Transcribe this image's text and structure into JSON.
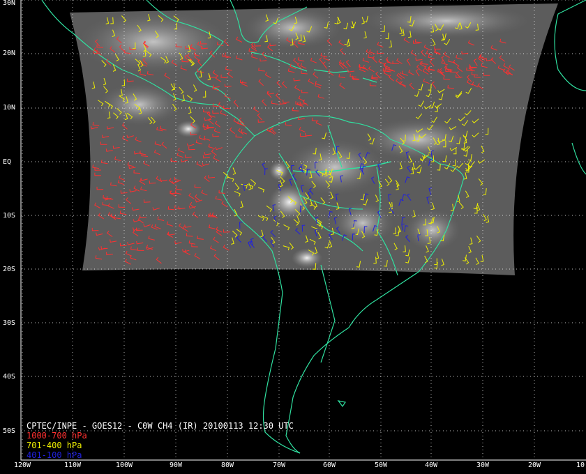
{
  "caption": "CPTEC/INPE - GOES12 - C0W CH4 (IR) 20100113 12:30 UTC",
  "legend": [
    {
      "label": "1000-700 hPa",
      "color": "#ff3030"
    },
    {
      "label": "701-400 hPa",
      "color": "#f0f000"
    },
    {
      "label": "401-100 hPa",
      "color": "#2020e0"
    }
  ],
  "lat_labels": [
    "30N",
    "20N",
    "10N",
    "EQ",
    "10S",
    "20S",
    "30S",
    "40S",
    "50S"
  ],
  "lon_labels": [
    "120W",
    "110W",
    "100W",
    "90W",
    "80W",
    "70W",
    "60W",
    "50W",
    "40W",
    "30W",
    "20W",
    "10"
  ],
  "colors": {
    "coast": "#30e0a0",
    "grid": "#ffffff",
    "background": "#000000",
    "imagery": "#5a5a5a"
  },
  "icons": [
    "wind-barb-icon"
  ]
}
